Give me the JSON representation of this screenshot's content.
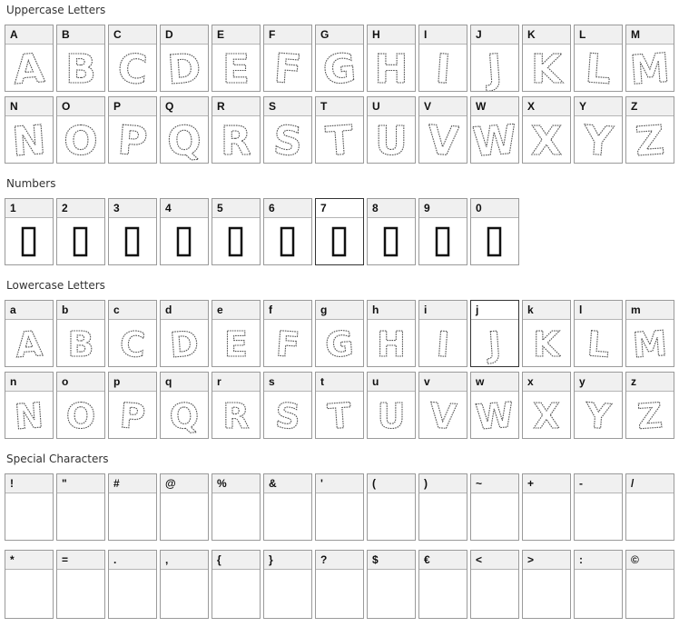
{
  "sections": [
    {
      "title": "Uppercase Letters",
      "rows": [
        [
          "A",
          "B",
          "C",
          "D",
          "E",
          "F",
          "G",
          "H",
          "I",
          "J",
          "K",
          "L",
          "M"
        ],
        [
          "N",
          "O",
          "P",
          "Q",
          "R",
          "S",
          "T",
          "U",
          "V",
          "W",
          "X",
          "Y",
          "Z"
        ]
      ]
    },
    {
      "title": "Numbers",
      "rows": [
        [
          "1",
          "2",
          "3",
          "4",
          "5",
          "6",
          "7",
          "8",
          "9",
          "0"
        ]
      ]
    },
    {
      "title": "Lowercase Letters",
      "rows": [
        [
          "a",
          "b",
          "c",
          "d",
          "e",
          "f",
          "g",
          "h",
          "i",
          "j",
          "k",
          "l",
          "m"
        ],
        [
          "n",
          "o",
          "p",
          "q",
          "r",
          "s",
          "t",
          "u",
          "v",
          "w",
          "x",
          "y",
          "z"
        ]
      ]
    },
    {
      "title": "Special Characters",
      "rows": [
        [
          "!",
          "\"",
          "#",
          "@",
          "%",
          "&",
          "'",
          "(",
          ")",
          "~",
          "+",
          "-",
          "/"
        ],
        [
          "*",
          "=",
          ".",
          ",",
          "{",
          "}",
          "?",
          "$",
          "€",
          "<",
          ">",
          ":",
          "©"
        ]
      ]
    }
  ],
  "colors": {
    "border": "#9a9a9a",
    "header_bg": "#f0f0f0",
    "glyph_stroke": "#555555"
  }
}
